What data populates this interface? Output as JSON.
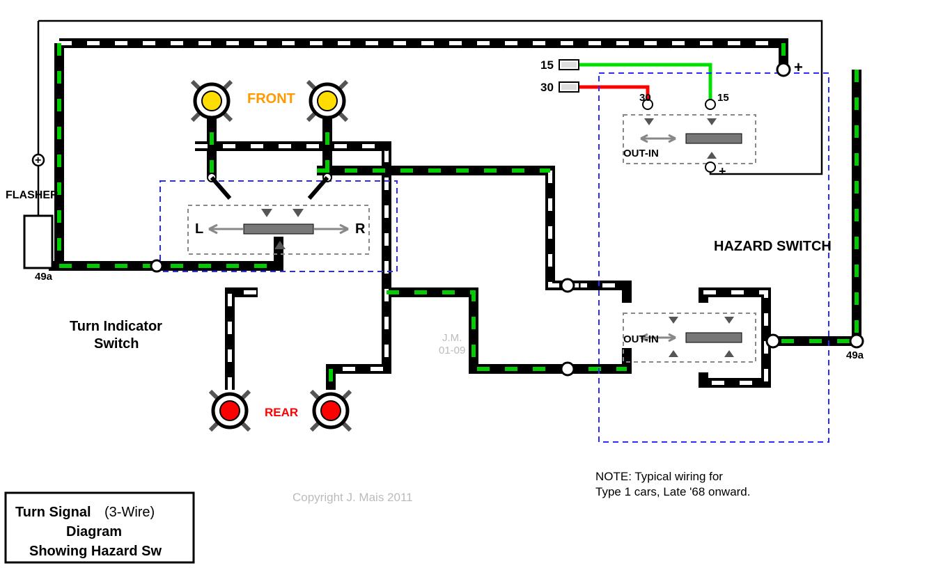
{
  "title_box": {
    "line1a": "Turn Signal",
    "line1b": "(3-Wire)",
    "line2": "Diagram",
    "line3": "Showing Hazard Sw"
  },
  "labels": {
    "flasher": "FLASHER",
    "front": "FRONT",
    "rear": "REAR",
    "hazard_switch": "HAZARD SWITCH",
    "turn_indicator_switch_1": "Turn Indicator",
    "turn_indicator_switch_2": "Switch",
    "L": "L",
    "R": "R",
    "L_small": "L",
    "R_small": "R",
    "out_in_upper": "OUT-IN",
    "out_in_lower": "OUT-IN",
    "terminal_15": "15",
    "terminal_30": "30",
    "sw_30": "30",
    "sw_15": "15",
    "plus1": "+",
    "plus2": "+",
    "terminal_49a_left": "49a",
    "terminal_49a_right": "49a"
  },
  "watermark": {
    "jm": "J.M.",
    "date": "01-09",
    "copyright": "Copyright J. Mais 2011"
  },
  "note": {
    "line1": "NOTE:  Typical wiring for",
    "line2": "Type 1 cars, Late '68 onward."
  },
  "colors": {
    "green": "#00cc00",
    "red": "#ff0000",
    "yellow": "#ffdd00",
    "orange": "#ff9900",
    "blue": "#0000ff",
    "gray": "#999999"
  }
}
